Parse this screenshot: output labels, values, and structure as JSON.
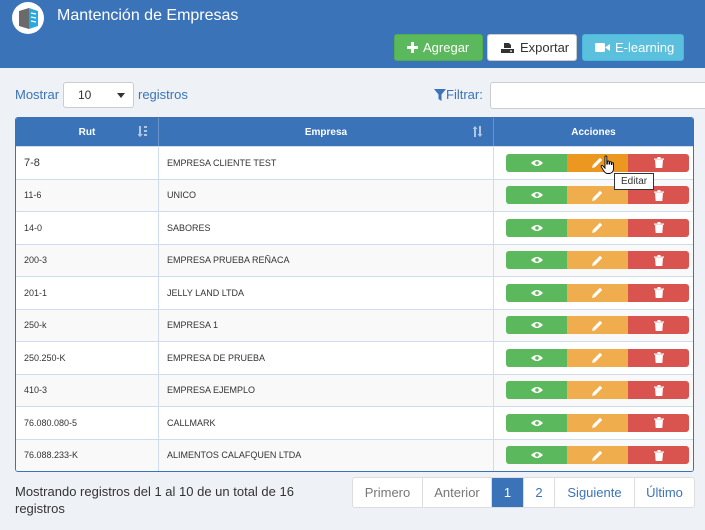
{
  "header": {
    "title": "Mantención de Empresas",
    "add_label": "Agregar",
    "export_label": "Exportar",
    "elearning_label": "E-learning"
  },
  "controls": {
    "show_label": "Mostrar",
    "page_size": "10",
    "records_label": "registros",
    "filter_label": "Filtrar:",
    "filter_value": ""
  },
  "table": {
    "columns": [
      "Rut",
      "Empresa",
      "Acciones"
    ],
    "rows": [
      {
        "rut": "7-8",
        "empresa": "EMPRESA CLIENTE TEST"
      },
      {
        "rut": "11-6",
        "empresa": "UNICO"
      },
      {
        "rut": "14-0",
        "empresa": "SABORES"
      },
      {
        "rut": "200-3",
        "empresa": "EMPRESA PRUEBA REÑACA"
      },
      {
        "rut": "201-1",
        "empresa": "JELLY LAND LTDA"
      },
      {
        "rut": "250-k",
        "empresa": "EMPRESA 1"
      },
      {
        "rut": "250.250-K",
        "empresa": "EMPRESA DE PRUEBA"
      },
      {
        "rut": "410-3",
        "empresa": "EMPRESA EJEMPLO"
      },
      {
        "rut": "76.080.080-5",
        "empresa": "CALLMARK"
      },
      {
        "rut": "76.088.233-K",
        "empresa": "ALIMENTOS CALAFQUEN LTDA"
      }
    ]
  },
  "tooltip": "Editar",
  "footer": {
    "info": "Mostrando registros del 1 al 10 de un total de 16 registros"
  },
  "pagination": [
    "Primero",
    "Anterior",
    "1",
    "2",
    "Siguiente",
    "Último"
  ],
  "colors": {
    "primary": "#3b73b9",
    "success": "#5cb85c",
    "warning": "#f0ad4e",
    "danger": "#d9534f",
    "info": "#5bc0de"
  },
  "icons": {
    "view": "eye-icon",
    "edit": "pencil-icon",
    "delete": "trash-icon"
  }
}
